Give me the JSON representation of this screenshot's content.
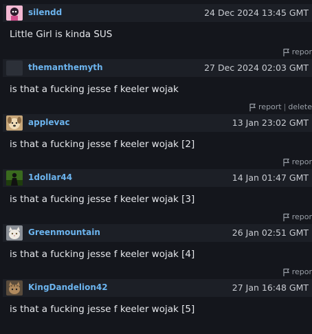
{
  "posts": [
    {
      "username": "silendd",
      "timestamp": "24 Dec 2024 13:45 GMT",
      "message": "Little Girl is kinda SUS",
      "actions": {
        "report": "repor"
      },
      "avatar": "pink-character-avatar"
    },
    {
      "username": "themanthemyth",
      "timestamp": "27 Dec 2024 02:03 GMT",
      "message": "is that a fucking jesse f keeler wojak",
      "actions": {
        "report": "report",
        "separator": "|",
        "delete": "delete"
      },
      "avatar": "gray-placeholder-avatar"
    },
    {
      "username": "applevac",
      "timestamp": "13 Jan 23:02 GMT",
      "message": "is that a fucking jesse f keeler wojak [2]",
      "actions": {
        "report": "repor"
      },
      "avatar": "dog-avatar"
    },
    {
      "username": "1dollar44",
      "timestamp": "14 Jan 01:47 GMT",
      "message": "is that a fucking jesse f keeler wojak [3]",
      "actions": {
        "report": "repor"
      },
      "avatar": "green-figure-avatar"
    },
    {
      "username": "Greenmountain",
      "timestamp": "26 Jan 02:51 GMT",
      "message": "is that a fucking jesse f keeler wojak [4]",
      "actions": {
        "report": "repor"
      },
      "avatar": "white-cat-avatar"
    },
    {
      "username": "KingDandelion42",
      "timestamp": "27 Jan 16:48 GMT",
      "message": "is that a fucking jesse f keeler wojak [5]",
      "actions": {
        "report": "repor"
      },
      "avatar": "tabby-cat-avatar"
    }
  ],
  "colors": {
    "background": "#14161c",
    "header": "#1c1f26",
    "username": "#6cb4ee",
    "muted": "#9aa0a8"
  }
}
